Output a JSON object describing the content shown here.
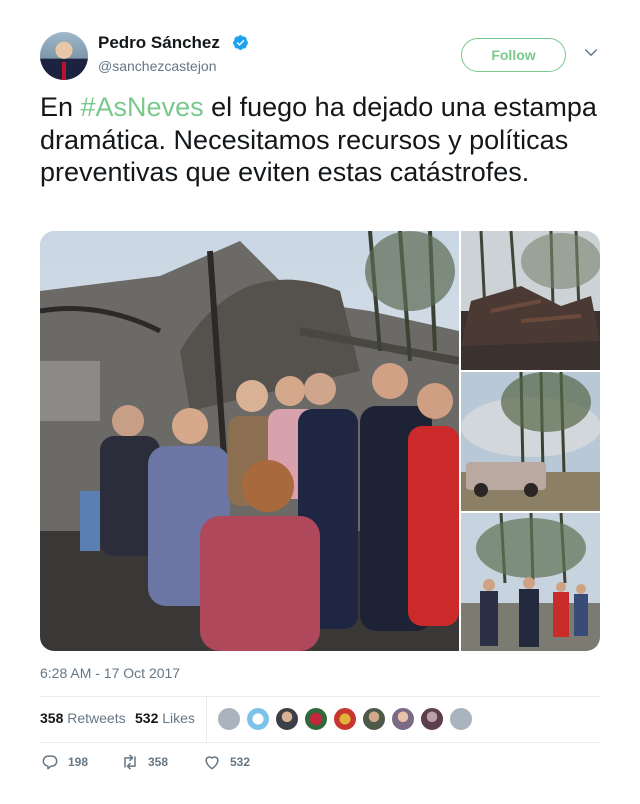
{
  "author": {
    "display_name": "Pedro Sánchez",
    "handle": "@sanchezcastejon",
    "verified": true
  },
  "follow_label": "Follow",
  "tweet": {
    "text_before": "En ",
    "hashtag": "#AsNeves",
    "text_after": " el fuego ha dejado una estampa dramática. Necesitamos recursos y políticas preventivas que eviten estas catástrofes."
  },
  "timestamp": "6:28 AM - 17 Oct 2017",
  "stats": {
    "retweets_count": "358",
    "retweets_label": "Retweets",
    "likes_count": "532",
    "likes_label": "Likes"
  },
  "actions": {
    "replies": "198",
    "retweets": "358",
    "likes": "532"
  },
  "colors": {
    "accent": "#79c98c",
    "verified": "#1da1f2",
    "secondary_text": "#657786",
    "divider": "#e6ecf0"
  },
  "icons": [
    "verified-badge-icon",
    "chevron-down-icon",
    "reply-icon",
    "retweet-icon",
    "heart-icon"
  ]
}
